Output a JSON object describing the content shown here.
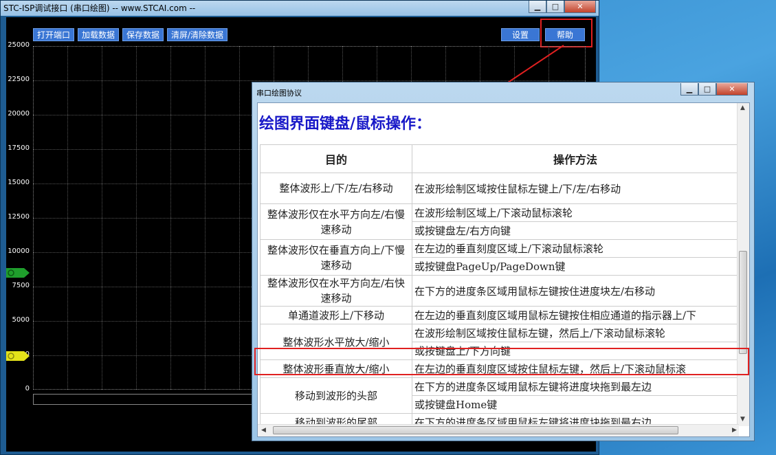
{
  "main_window": {
    "title": "STC-ISP调试接口 (串口绘图) -- www.STCAI.com --",
    "caption_buttons": {
      "minimize": "▁",
      "maximize": "□",
      "close": "✕"
    },
    "toolbar": {
      "open_port": "打开端口",
      "load_data": "加载数据",
      "save_data": "保存数据",
      "clear_data": "清屏/清除数据",
      "settings": "设置",
      "help": "帮助"
    },
    "y_axis_ticks": [
      "25000",
      "22500",
      "20000",
      "17500",
      "15000",
      "12500",
      "10000",
      "7500",
      "5000",
      "2500",
      "0"
    ],
    "channel_colors": {
      "ch1": "#1f9e2c",
      "ch2": "#e4e21a"
    },
    "plot_bg": "#000000"
  },
  "dialog": {
    "title": "串口绘图协议",
    "caption_buttons": {
      "minimize": "▁",
      "maximize": "□",
      "close": "✕"
    },
    "heading": "绘图界面键盘/鼠标操作：",
    "table": {
      "header_goal": "目的",
      "header_method": "操作方法",
      "rows": [
        {
          "goal": "整体波形上/下/左/右移动",
          "methods": [
            "在波形绘制区域按住鼠标左键上/下/左/右移动"
          ]
        },
        {
          "goal": "整体波形仅在水平方向左/右慢速移动",
          "methods": [
            "在波形绘制区域上/下滚动鼠标滚轮",
            "或按键盘左/右方向键"
          ]
        },
        {
          "goal": "整体波形仅在垂直方向上/下慢速移动",
          "methods": [
            "在左边的垂直刻度区域上/下滚动鼠标滚轮",
            "或按键盘PageUp/PageDown键"
          ]
        },
        {
          "goal": "整体波形仅在水平方向左/右快速移动",
          "methods": [
            "在下方的进度条区域用鼠标左键按住进度块左/右移动"
          ]
        },
        {
          "goal": "单通道波形上/下移动",
          "methods": [
            "在左边的垂直刻度区域用鼠标左键按住相应通道的指示器上/下"
          ]
        },
        {
          "goal": "整体波形水平放大/缩小",
          "methods": [
            "在波形绘制区域按住鼠标左键，然后上/下滚动鼠标滚轮",
            "或按键盘上/下方向键"
          ]
        },
        {
          "goal": "整体波形垂直放大/缩小",
          "methods": [
            "在左边的垂直刻度区域按住鼠标左键，然后上/下滚动鼠标滚"
          ]
        },
        {
          "goal": "移动到波形的头部",
          "methods": [
            "在下方的进度条区域用鼠标左键将进度块拖到最左边",
            "或按键盘Home键"
          ]
        },
        {
          "goal": "移动到波形的尾部",
          "methods": [
            "在下方的进度条区域用鼠标左键将进度块拖到最右边"
          ]
        }
      ]
    }
  },
  "accent": {
    "highlight_red": "#e02020",
    "heading_blue": "#1818c8"
  }
}
